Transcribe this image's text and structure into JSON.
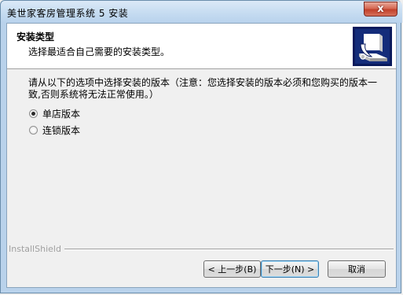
{
  "window": {
    "title": "美世家客房管理系统 5 安装",
    "close_label": "x"
  },
  "header": {
    "title": "安装类型",
    "subtitle": "选择最适合自己需要的安装类型。",
    "logo_icon": "installer-box-icon"
  },
  "body": {
    "instruction": "请从以下的选项中选择安装的版本（注意：您选择安装的版本必须和您购买的版本一致,否则系统将无法正常使用。）",
    "options": [
      {
        "label": "单店版本",
        "selected": true
      },
      {
        "label": "连锁版本",
        "selected": false
      }
    ]
  },
  "footer": {
    "brand": "InstallShield",
    "back_label": "< 上一步(B)",
    "next_label": "下一步(N) >",
    "cancel_label": "取消"
  },
  "colors": {
    "titlebar": "#c6dcf1",
    "close_button": "#c1412b",
    "default_button_border": "#3c7fb1"
  }
}
